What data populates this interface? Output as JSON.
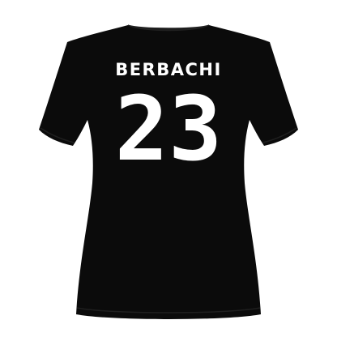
{
  "jersey": {
    "player_name": "BERBACHI",
    "player_number": "23",
    "shirt_color": "#0a0a0a",
    "print_color": "#ffffff",
    "background_color": "#ffffff"
  }
}
